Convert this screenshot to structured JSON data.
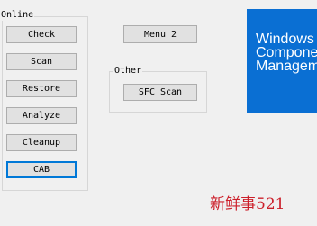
{
  "groups": {
    "online": {
      "label": "Online",
      "buttons": [
        {
          "label": "Check"
        },
        {
          "label": "Scan"
        },
        {
          "label": "Restore"
        },
        {
          "label": "Analyze"
        },
        {
          "label": "Cleanup"
        },
        {
          "label": "CAB"
        }
      ]
    },
    "other": {
      "label": "Other",
      "buttons": [
        {
          "label": "SFC Scan"
        }
      ]
    }
  },
  "menu2_label": "Menu 2",
  "banner": {
    "text": "Windows\nComponent\nManagement",
    "color": "#0a6fd3"
  },
  "watermark": {
    "text": "新鲜事521",
    "color": "#cc1f2a"
  },
  "colors": {
    "default_button_border": "#0078d7"
  }
}
